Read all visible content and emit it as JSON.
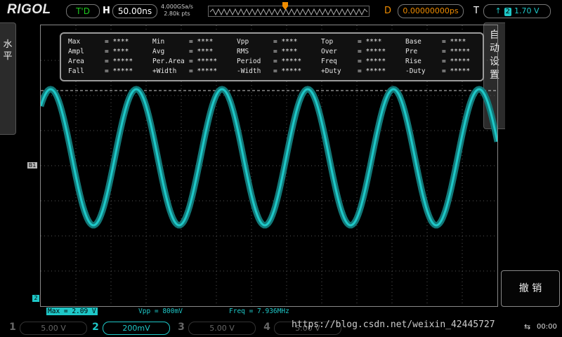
{
  "header": {
    "logo": "RIGOL",
    "trigger_status": "T'D",
    "horizontal_label": "H",
    "timebase": "50.00ns",
    "sample_rate": "4.000GSa/s",
    "memory_depth": "2.80k pts",
    "delay_label": "D",
    "delay_value": "0.00000000ps",
    "trigger_label": "T",
    "trigger_channel": "2",
    "trigger_level": "1.70 V"
  },
  "left_tab": {
    "label": "水平"
  },
  "right_tab": {
    "label": "自动设置"
  },
  "measurements": [
    [
      {
        "k": "Max",
        "v": "= ****"
      },
      {
        "k": "Min",
        "v": "= ****"
      },
      {
        "k": "Vpp",
        "v": "= ****"
      },
      {
        "k": "Top",
        "v": "= ****"
      },
      {
        "k": "Base",
        "v": "= ****"
      }
    ],
    [
      {
        "k": "Ampl",
        "v": "= ****"
      },
      {
        "k": "Avg",
        "v": "= ****"
      },
      {
        "k": "RMS",
        "v": "= ****"
      },
      {
        "k": "Over",
        "v": "= *****"
      },
      {
        "k": "Pre",
        "v": "= *****"
      }
    ],
    [
      {
        "k": "Area",
        "v": "= *****"
      },
      {
        "k": "Per.Area",
        "v": "= *****"
      },
      {
        "k": "Period",
        "v": "= *****"
      },
      {
        "k": "Freq",
        "v": "= *****"
      },
      {
        "k": "Rise",
        "v": "= *****"
      }
    ],
    [
      {
        "k": "Fall",
        "v": "= *****"
      },
      {
        "k": "+Width",
        "v": "= *****"
      },
      {
        "k": "-Width",
        "v": "= *****"
      },
      {
        "k": "+Duty",
        "v": "= *****"
      },
      {
        "k": "-Duty",
        "v": "= *****"
      }
    ]
  ],
  "bottom_measurements": {
    "max": "Max = 2.09 V",
    "vpp": "Vpp = 800mV",
    "freq": "Freq = 7.936MHz"
  },
  "softkey": {
    "undo": "撤 销"
  },
  "channels": [
    {
      "num": "1",
      "value": "5.00 V",
      "active": false
    },
    {
      "num": "2",
      "value": "200mV",
      "active": true
    },
    {
      "num": "3",
      "value": "5.00 V",
      "active": false
    },
    {
      "num": "4",
      "value": "5.00 V",
      "active": false
    }
  ],
  "watermark": "https://blog.csdn.net/weixin_42445727",
  "clock": "00:00",
  "markers": {
    "channel_ref": "B1",
    "ground_ref": "2"
  },
  "colors": {
    "trace": "#1ec8c8",
    "trigger": "#1ec81e",
    "delay": "#f08c00"
  },
  "icons": [
    "trigger-edge-icon",
    "usb-icon",
    "delay-marker-icon"
  ]
}
